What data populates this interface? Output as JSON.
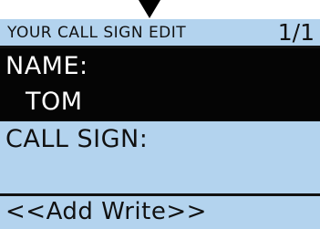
{
  "screen": {
    "title": "YOUR CALL SIGN EDIT",
    "page_indicator": "1/1"
  },
  "fields": {
    "name_label": "NAME:",
    "name_value": "TOM",
    "callsign_label": "CALL SIGN:",
    "callsign_value": ""
  },
  "actions": {
    "add_write_label": "<<Add Write>>"
  },
  "colors": {
    "lcd_background": "#b3d3ee",
    "selected_row_background": "#050505",
    "selected_row_text": "#ffffff",
    "text": "#111111"
  },
  "icons": {
    "pointer": "down-arrow-icon"
  }
}
